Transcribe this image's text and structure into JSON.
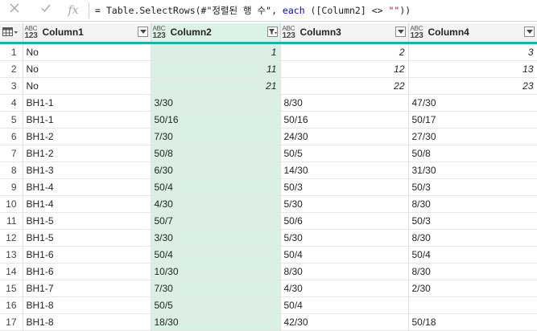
{
  "formula": {
    "prefix": "= Table.SelectRows(#\"정렬된 행 수\", ",
    "keyword": "each",
    "middle": " ([Column2] <> ",
    "string": "\"\"",
    "suffix": "))"
  },
  "icons": {
    "cancel": "cancel-x-icon",
    "commit": "check-icon",
    "fx": "fx-icon",
    "fx_label": "fx",
    "table": "table-menu-icon"
  },
  "colors": {
    "selected_column_bg": "#d9f0e2",
    "header_accent": "#1bb4a0"
  },
  "columns": [
    {
      "name": "Column1",
      "type_line1": "ABC",
      "type_line2": "123"
    },
    {
      "name": "Column2",
      "type_line1": "ABC",
      "type_line2": "123",
      "filtered": true
    },
    {
      "name": "Column3",
      "type_line1": "ABC",
      "type_line2": "123"
    },
    {
      "name": "Column4",
      "type_line1": "ABC",
      "type_line2": "123"
    }
  ],
  "rows": [
    {
      "n": "1",
      "c1": "No",
      "c2": "1",
      "c3": "2",
      "c4": "3",
      "numeric": true
    },
    {
      "n": "2",
      "c1": "No",
      "c2": "11",
      "c3": "12",
      "c4": "13",
      "numeric": true
    },
    {
      "n": "3",
      "c1": "No",
      "c2": "21",
      "c3": "22",
      "c4": "23",
      "numeric": true
    },
    {
      "n": "4",
      "c1": "BH1-1",
      "c2": "3/30",
      "c3": "8/30",
      "c4": "47/30"
    },
    {
      "n": "5",
      "c1": "BH1-1",
      "c2": "50/16",
      "c3": "50/16",
      "c4": "50/17"
    },
    {
      "n": "6",
      "c1": "BH1-2",
      "c2": "7/30",
      "c3": "24/30",
      "c4": "27/30"
    },
    {
      "n": "7",
      "c1": "BH1-2",
      "c2": "50/8",
      "c3": "50/5",
      "c4": "50/8"
    },
    {
      "n": "8",
      "c1": "BH1-3",
      "c2": "6/30",
      "c3": "14/30",
      "c4": "31/30"
    },
    {
      "n": "9",
      "c1": "BH1-4",
      "c2": "50/4",
      "c3": "50/3",
      "c4": "50/3"
    },
    {
      "n": "10",
      "c1": "BH1-4",
      "c2": "4/30",
      "c3": "5/30",
      "c4": "8/30"
    },
    {
      "n": "11",
      "c1": "BH1-5",
      "c2": "50/7",
      "c3": "50/6",
      "c4": "50/3"
    },
    {
      "n": "12",
      "c1": "BH1-5",
      "c2": "3/30",
      "c3": "5/30",
      "c4": "8/30"
    },
    {
      "n": "13",
      "c1": "BH1-6",
      "c2": "50/4",
      "c3": "50/4",
      "c4": "50/4"
    },
    {
      "n": "14",
      "c1": "BH1-6",
      "c2": "10/30",
      "c3": "8/30",
      "c4": "8/30"
    },
    {
      "n": "15",
      "c1": "BH1-7",
      "c2": "7/30",
      "c3": "4/30",
      "c4": "2/30"
    },
    {
      "n": "16",
      "c1": "BH1-8",
      "c2": "50/5",
      "c3": "50/4",
      "c4": ""
    },
    {
      "n": "17",
      "c1": "BH1-8",
      "c2": "18/30",
      "c3": "42/30",
      "c4": "50/18"
    }
  ]
}
